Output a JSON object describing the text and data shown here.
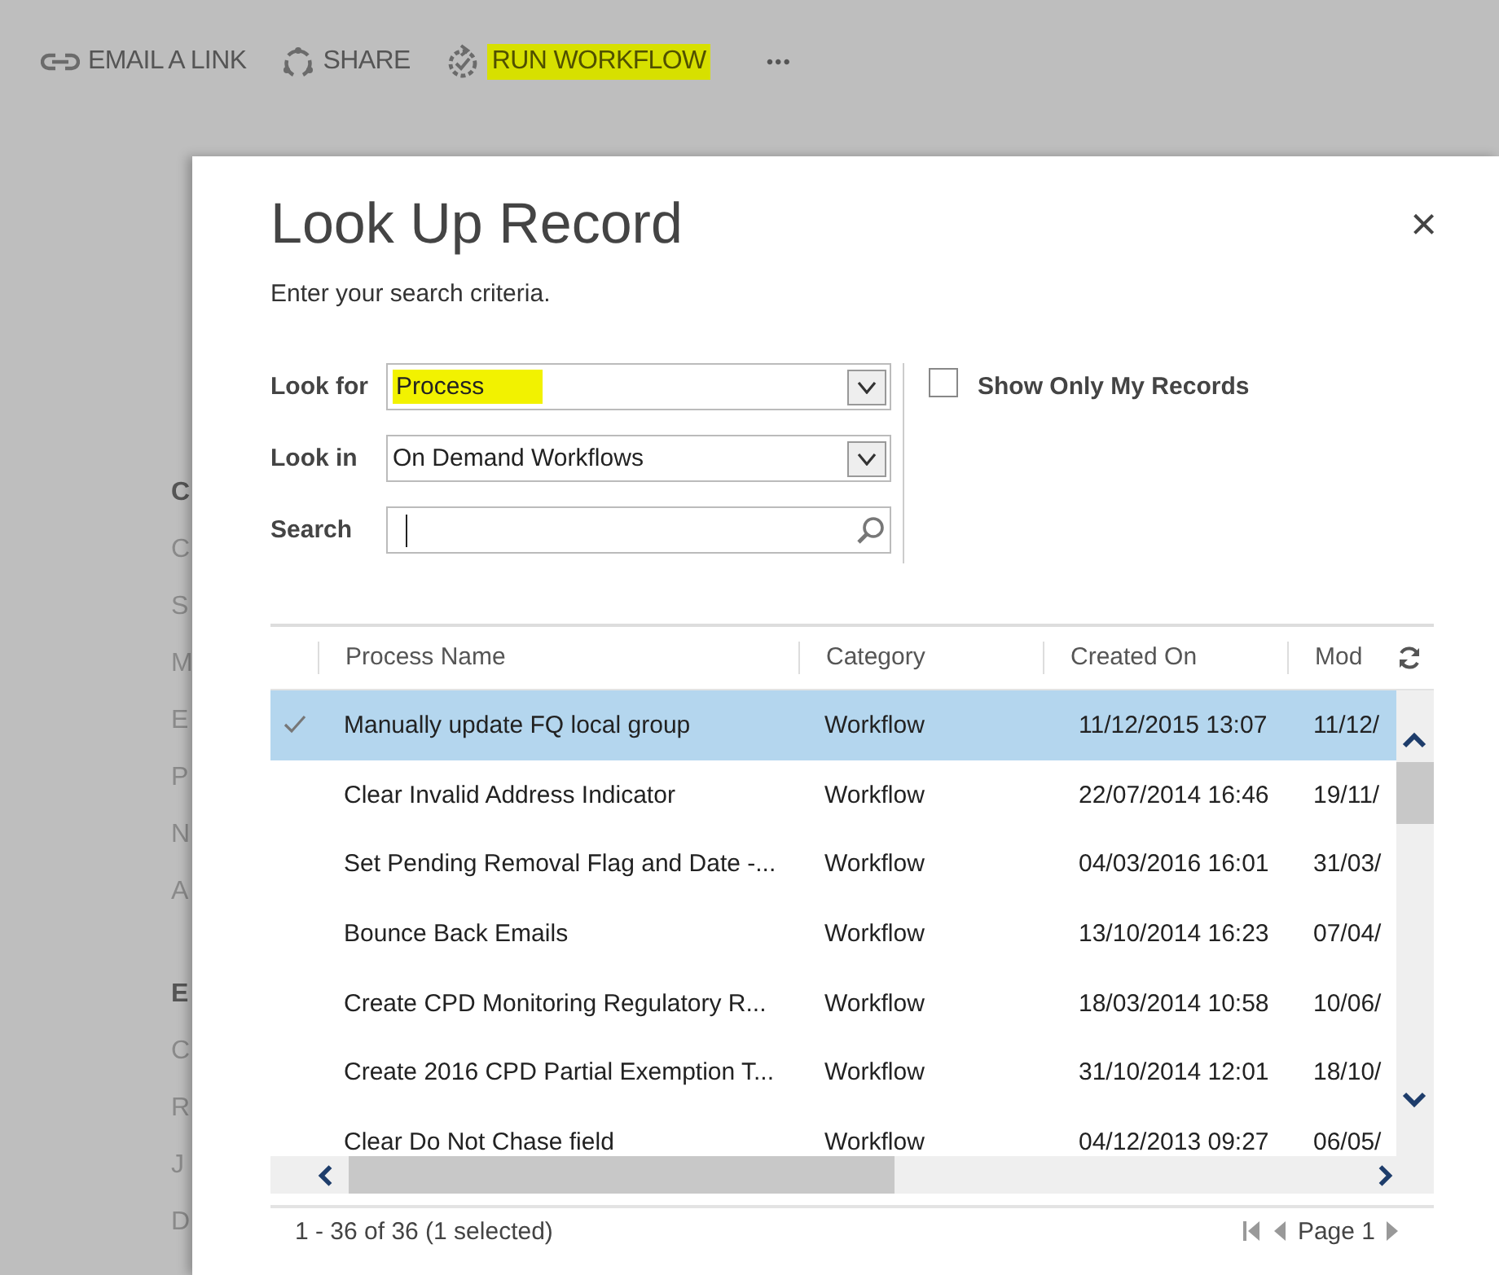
{
  "toolbar": [
    {
      "kind": "link",
      "label": "EMAIL A LINK",
      "highlighted": false
    },
    {
      "kind": "share",
      "label": "SHARE",
      "highlighted": false
    },
    {
      "kind": "workflow",
      "label": "RUN WORKFLOW",
      "highlighted": true
    },
    {
      "kind": "more",
      "label": "•••",
      "highlighted": false
    }
  ],
  "background_form": [
    {
      "text": "C",
      "kind": "header"
    },
    {
      "text": "C",
      "kind": "field"
    },
    {
      "text": "S",
      "kind": "field"
    },
    {
      "text": "M",
      "kind": "field"
    },
    {
      "text": "E",
      "kind": "field"
    },
    {
      "text": "P",
      "kind": "field"
    },
    {
      "text": "N",
      "kind": "field"
    },
    {
      "text": "A",
      "kind": "field"
    },
    {
      "text": "E",
      "kind": "header"
    },
    {
      "text": "C",
      "kind": "field"
    },
    {
      "text": "R",
      "kind": "field"
    },
    {
      "text": "J",
      "kind": "field"
    },
    {
      "text": "D",
      "kind": "field"
    }
  ],
  "dialog": {
    "title": "Look Up Record",
    "subtitle": "Enter your search criteria.",
    "close": "×",
    "look_for": {
      "label": "Look for",
      "value": "Process",
      "highlighted": true
    },
    "look_in": {
      "label": "Look in",
      "value": "On Demand Workflows"
    },
    "search": {
      "label": "Search"
    },
    "show_only_mine": {
      "label": "Show Only My Records",
      "checked": false
    },
    "table": {
      "columns": [
        "Process Name",
        "Category",
        "Created On",
        "Mod"
      ],
      "rows": [
        {
          "selected": true,
          "cells": [
            "Manually update FQ local group",
            "Workflow",
            "11/12/2015 13:07",
            "11/12/"
          ]
        },
        {
          "selected": false,
          "cells": [
            "Clear Invalid Address Indicator",
            "Workflow",
            "22/07/2014 16:46",
            "19/11/"
          ]
        },
        {
          "selected": false,
          "cells": [
            "Set Pending Removal Flag and Date -...",
            "Workflow",
            "04/03/2016 16:01",
            "31/03/"
          ]
        },
        {
          "selected": false,
          "cells": [
            "Bounce Back Emails",
            "Workflow",
            "13/10/2014 16:23",
            "07/04/"
          ]
        },
        {
          "selected": false,
          "cells": [
            "Create CPD Monitoring Regulatory R...",
            "Workflow",
            "18/03/2014 10:58",
            "10/06/"
          ]
        },
        {
          "selected": false,
          "cells": [
            "Create 2016 CPD Partial Exemption T...",
            "Workflow",
            "31/10/2014 12:01",
            "18/10/"
          ]
        },
        {
          "selected": false,
          "cells": [
            "Clear Do Not Chase field",
            "Workflow",
            "04/12/2013 09:27",
            "06/05/"
          ]
        }
      ]
    },
    "status": "1 - 36 of 36 (1 selected)",
    "page": "Page 1"
  }
}
